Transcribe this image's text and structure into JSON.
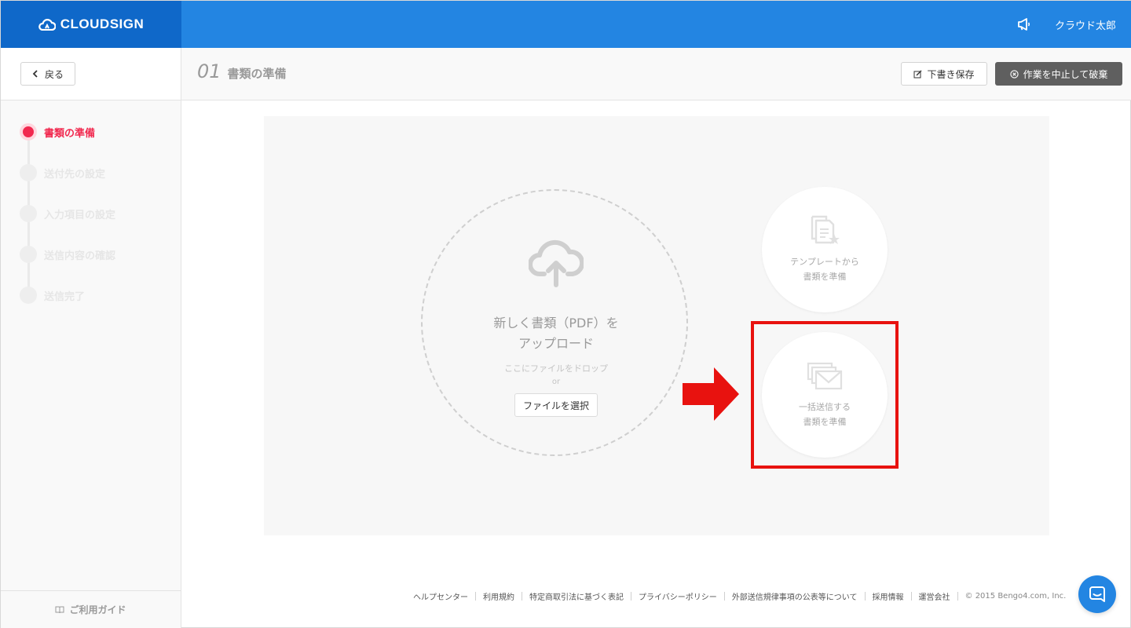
{
  "header": {
    "brand": "CLOUDSIGN",
    "user_name": "クラウド太郎",
    "announcement_icon": "megaphone-icon"
  },
  "subheader": {
    "back_label": "戻る",
    "step_number": "01",
    "step_title": "書類の準備",
    "save_draft_label": "下書き保存",
    "cancel_label": "作業を中止して破棄"
  },
  "sidebar": {
    "steps": [
      {
        "label": "書類の準備",
        "active": true
      },
      {
        "label": "送付先の設定",
        "active": false
      },
      {
        "label": "入力項目の設定",
        "active": false
      },
      {
        "label": "送信内容の確認",
        "active": false
      },
      {
        "label": "送信完了",
        "active": false
      }
    ],
    "guide_label": "ご利用ガイド"
  },
  "upload": {
    "title_line1": "新しく書類（PDF）を",
    "title_line2": "アップロード",
    "drop_text": "ここにファイルをドロップ",
    "or_text": "or",
    "select_label": "ファイルを選択"
  },
  "options": {
    "template_line1": "テンプレートから",
    "template_line2": "書類を準備",
    "bulk_line1": "一括送信する",
    "bulk_line2": "書類を準備"
  },
  "footer": {
    "links": [
      "ヘルプセンター",
      "利用規約",
      "特定商取引法に基づく表記",
      "プライバシーポリシー",
      "外部送信規律事項の公表等について",
      "採用情報",
      "運営会社"
    ],
    "copyright": "© 2015 Bengo4.com, Inc."
  },
  "colors": {
    "brand_dark": "#0f68c9",
    "brand": "#2385e2",
    "active_step": "#f1294f",
    "highlight": "#e8120f"
  }
}
